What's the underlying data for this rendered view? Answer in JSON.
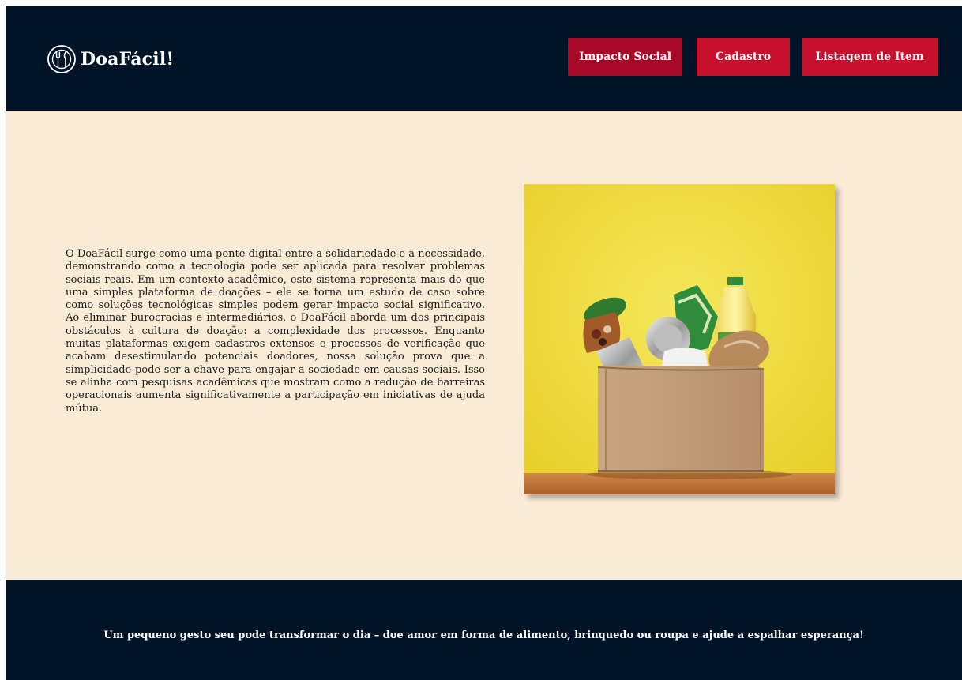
{
  "header": {
    "brand": "DoaFácil!",
    "brand_icon": "plate-cutlery-icon",
    "nav": [
      {
        "label": "Impacto Social",
        "active": true
      },
      {
        "label": "Cadastro",
        "active": false
      },
      {
        "label": "Listagem de Item",
        "active": false
      }
    ]
  },
  "main": {
    "paragraph": "O DoaFácil surge como uma ponte digital entre a solidariedade e a necessidade, demonstrando como a tecnologia pode ser aplicada para resolver problemas sociais reais. Em um contexto acadêmico, este sistema representa mais do que uma simples plataforma de doações – ele se torna um estudo de caso sobre como soluções tecnológicas simples podem gerar impacto social significativo. Ao eliminar burocracias e intermediários, o DoaFácil aborda um dos principais obstáculos à cultura de doação: a complexidade dos processos. Enquanto muitas plataformas exigem cadastros extensos e processos de verificação que acabam desestimulando potenciais doadores, nossa solução prova que a simplicidade pode ser a chave para engajar a sociedade em causas sociais. Isso se alinha com pesquisas acadêmicas que mostram como a redução de barreiras operacionais aumenta significativamente a participação em iniciativas de ajuda mútua.",
    "image_icon": "donation-box-photo"
  },
  "footer": {
    "slogan": "Um pequeno gesto seu pode transformar o dia – doe amor em forma de alimento, brinquedo ou roupa e ajude a espalhar esperança!"
  },
  "colors": {
    "navy": "#021427",
    "crimson": "#c8102e",
    "crimson_active": "#a70a26",
    "cream": "#faebd7"
  }
}
